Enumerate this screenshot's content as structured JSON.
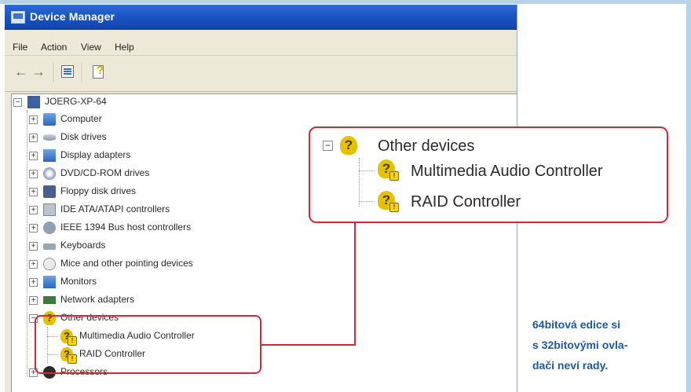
{
  "window": {
    "title": "Device Manager"
  },
  "menu": [
    "File",
    "Action",
    "View",
    "Help"
  ],
  "toolbar": {
    "back": "←",
    "forward": "→"
  },
  "tree": {
    "root": "JOERG-XP-64",
    "items": [
      {
        "label": "Computer",
        "icon": "computer-icon"
      },
      {
        "label": "Disk drives",
        "icon": "disk-drive-icon"
      },
      {
        "label": "Display adapters",
        "icon": "display-adapter-icon"
      },
      {
        "label": "DVD/CD-ROM drives",
        "icon": "dvd-drive-icon"
      },
      {
        "label": "Floppy disk drives",
        "icon": "floppy-drive-icon"
      },
      {
        "label": "IDE ATA/ATAPI controllers",
        "icon": "ide-controller-icon"
      },
      {
        "label": "IEEE 1394 Bus host controllers",
        "icon": "ieee1394-icon"
      },
      {
        "label": "Keyboards",
        "icon": "keyboard-icon"
      },
      {
        "label": "Mice and other pointing devices",
        "icon": "mouse-icon"
      },
      {
        "label": "Monitors",
        "icon": "monitor-icon"
      },
      {
        "label": "Network adapters",
        "icon": "network-adapter-icon"
      }
    ],
    "other_devices": {
      "label": "Other devices",
      "children": [
        "Multimedia Audio Controller",
        "RAID Controller"
      ]
    },
    "processors": "Processors"
  },
  "zoom": {
    "label": "Other devices",
    "children": [
      "Multimedia Audio Controller",
      "RAID Controller"
    ]
  },
  "caption": [
    "64bitová edice si",
    "s 32bitovými ovla-",
    "dači neví rady."
  ],
  "colors": {
    "highlight": "#d62838",
    "caption": "#1a5aa4",
    "titlebar": "#1b54c4"
  }
}
